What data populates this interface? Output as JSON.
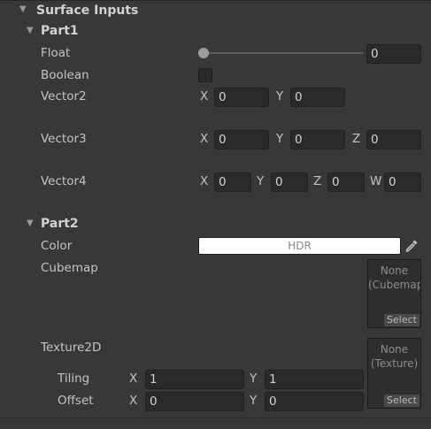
{
  "section": {
    "title": "Surface Inputs"
  },
  "part1": {
    "title": "Part1",
    "float": {
      "label": "Float",
      "value": "0",
      "slider_fraction": 0
    },
    "boolean": {
      "label": "Boolean"
    },
    "vector2": {
      "label": "Vector2",
      "x_label": "X",
      "x": "0",
      "y_label": "Y",
      "y": "0"
    },
    "vector3": {
      "label": "Vector3",
      "x_label": "X",
      "x": "0",
      "y_label": "Y",
      "y": "0",
      "z_label": "Z",
      "z": "0"
    },
    "vector4": {
      "label": "Vector4",
      "x_label": "X",
      "x": "0",
      "y_label": "Y",
      "y": "0",
      "z_label": "Z",
      "z": "0",
      "w_label": "W",
      "w": "0"
    }
  },
  "part2": {
    "title": "Part2",
    "color": {
      "label": "Color",
      "mode": "HDR"
    },
    "cubemap": {
      "label": "Cubemap",
      "slot_text": "None (Cubemap)",
      "select_label": "Select"
    },
    "texture2d": {
      "label": "Texture2D",
      "slot_text": "None (Texture)",
      "select_label": "Select",
      "tiling": {
        "label": "Tiling",
        "x_label": "X",
        "x": "1",
        "y_label": "Y",
        "y": "1"
      },
      "offset": {
        "label": "Offset",
        "x_label": "X",
        "x": "0",
        "y_label": "Y",
        "y": "0"
      }
    }
  },
  "colors": {
    "background": "#383838",
    "field": "#2a2a2a",
    "text": "#c4c4c4",
    "color_swatch": "#ffffff"
  }
}
